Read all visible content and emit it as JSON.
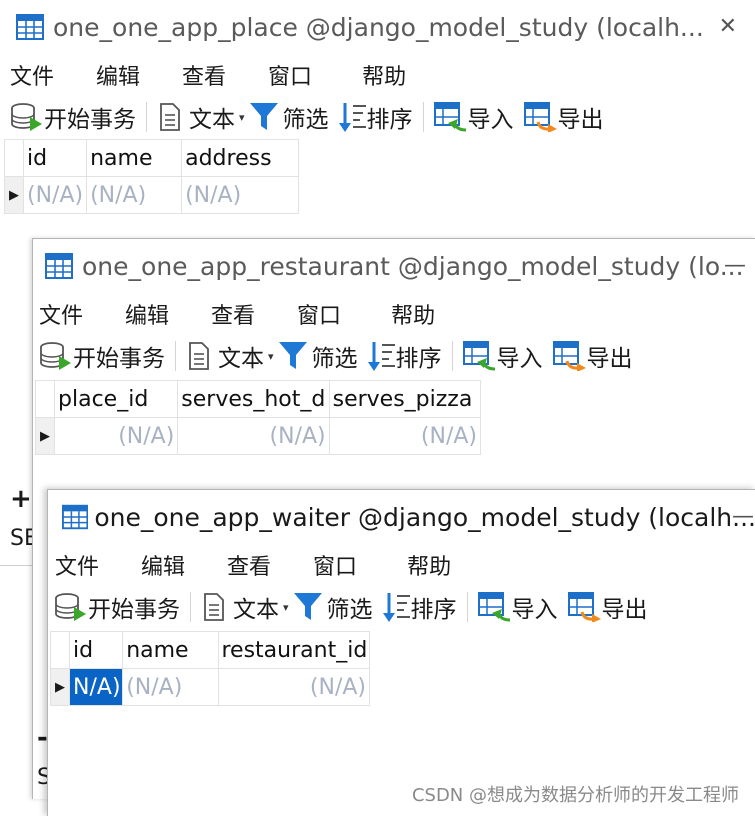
{
  "windows": [
    {
      "title": "one_one_app_place @django_model_study (localh...",
      "close": "✕",
      "menu": [
        "文件",
        "编辑",
        "查看",
        "窗口",
        "帮助"
      ],
      "toolbar": {
        "begin": "开始事务",
        "text": "文本",
        "filter": "筛选",
        "sort": "排序",
        "import": "导入",
        "export": "导出"
      },
      "columns": [
        "id",
        "name",
        "address"
      ],
      "row": [
        "(N/A)",
        "(N/A)",
        "(N/A)"
      ]
    },
    {
      "title": "one_one_app_restaurant @django_model_study (lo...",
      "close": "—",
      "menu": [
        "文件",
        "编辑",
        "查看",
        "窗口",
        "帮助"
      ],
      "toolbar": {
        "begin": "开始事务",
        "text": "文本",
        "filter": "筛选",
        "sort": "排序",
        "import": "导入",
        "export": "导出"
      },
      "columns": [
        "place_id",
        "serves_hot_d",
        "serves_pizza"
      ],
      "row": [
        "(N/A)",
        "(N/A)",
        "(N/A)"
      ]
    },
    {
      "title": "one_one_app_waiter @django_model_study (localh...",
      "close": "—",
      "menu": [
        "文件",
        "编辑",
        "查看",
        "窗口",
        "帮助"
      ],
      "toolbar": {
        "begin": "开始事务",
        "text": "文本",
        "filter": "筛选",
        "sort": "排序",
        "import": "导入",
        "export": "导出"
      },
      "columns": [
        "id",
        "name",
        "restaurant_id"
      ],
      "row": [
        "N/A)",
        "(N/A)",
        "(N/A)"
      ]
    }
  ],
  "bg_fragments": {
    "plus": "+",
    "se": "SE",
    "minus": "-",
    "s": "S"
  },
  "watermark": "CSDN @想成为数据分析师的开发工程师",
  "colors": {
    "accent": "#1e6fc7",
    "selected": "#0a64c6",
    "placeholder": "#a9b2c3"
  }
}
